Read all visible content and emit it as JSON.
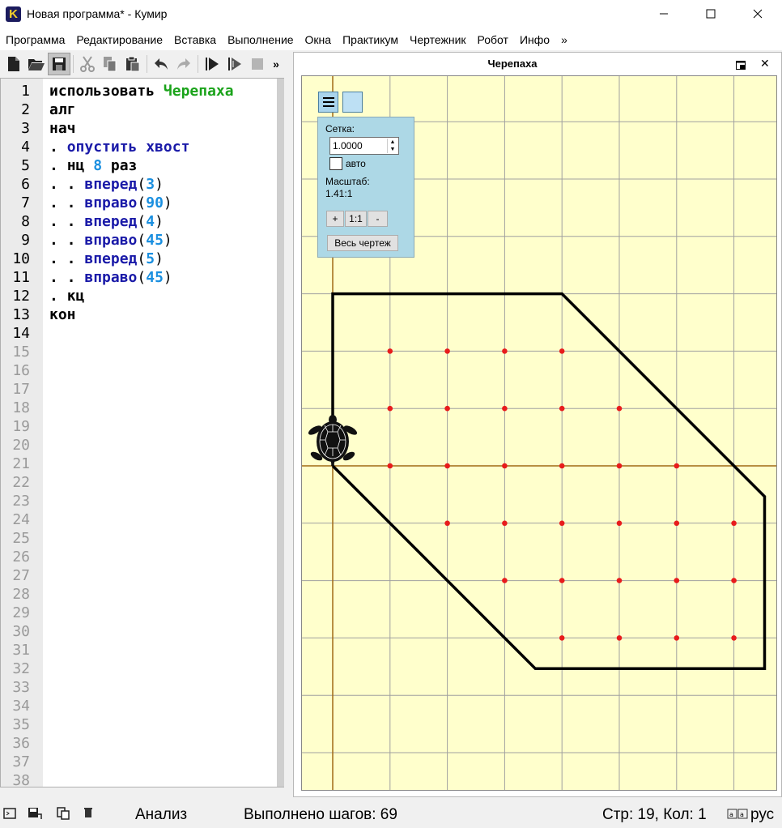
{
  "window": {
    "title": "Новая программа* - Кумир",
    "icon_letter": "K"
  },
  "menu": [
    "Программа",
    "Редактирование",
    "Вставка",
    "Выполнение",
    "Окна",
    "Практикум",
    "Чертежник",
    "Робот",
    "Инфо",
    "»"
  ],
  "toolbar": {
    "icons": [
      "new-file-icon",
      "open-folder-icon",
      "save-icon",
      "cut-icon",
      "copy-icon",
      "paste-icon",
      "undo-icon",
      "redo-icon",
      "run-icon",
      "step-icon",
      "stop-icon"
    ],
    "more_label": "»"
  },
  "editor": {
    "line_count": 38,
    "filled_lines": 14,
    "lines": [
      [
        {
          "t": "использовать ",
          "c": "kw"
        },
        {
          "t": "Черепаха",
          "c": "mod"
        }
      ],
      [
        {
          "t": "алг",
          "c": "kw"
        }
      ],
      [
        {
          "t": "нач",
          "c": "kw"
        }
      ],
      [
        {
          "t": ". ",
          "c": "dot"
        },
        {
          "t": "опустить хвост",
          "c": "cmd"
        }
      ],
      [
        {
          "t": ". ",
          "c": "dot"
        },
        {
          "t": "нц ",
          "c": "kw"
        },
        {
          "t": "8",
          "c": "num"
        },
        {
          "t": " раз",
          "c": "kw"
        }
      ],
      [
        {
          "t": ". . ",
          "c": "dot"
        },
        {
          "t": "вперед",
          "c": "cmd"
        },
        {
          "t": "(",
          "c": ""
        },
        {
          "t": "3",
          "c": "num"
        },
        {
          "t": ")",
          "c": ""
        }
      ],
      [
        {
          "t": ". . ",
          "c": "dot"
        },
        {
          "t": "вправо",
          "c": "cmd"
        },
        {
          "t": "(",
          "c": ""
        },
        {
          "t": "90",
          "c": "num"
        },
        {
          "t": ")",
          "c": ""
        }
      ],
      [
        {
          "t": ". . ",
          "c": "dot"
        },
        {
          "t": "вперед",
          "c": "cmd"
        },
        {
          "t": "(",
          "c": ""
        },
        {
          "t": "4",
          "c": "num"
        },
        {
          "t": ")",
          "c": ""
        }
      ],
      [
        {
          "t": ". . ",
          "c": "dot"
        },
        {
          "t": "вправо",
          "c": "cmd"
        },
        {
          "t": "(",
          "c": ""
        },
        {
          "t": "45",
          "c": "num"
        },
        {
          "t": ")",
          "c": ""
        }
      ],
      [
        {
          "t": ". . ",
          "c": "dot"
        },
        {
          "t": "вперед",
          "c": "cmd"
        },
        {
          "t": "(",
          "c": ""
        },
        {
          "t": "5",
          "c": "num"
        },
        {
          "t": ")",
          "c": ""
        }
      ],
      [
        {
          "t": ". . ",
          "c": "dot"
        },
        {
          "t": "вправо",
          "c": "cmd"
        },
        {
          "t": "(",
          "c": ""
        },
        {
          "t": "45",
          "c": "num"
        },
        {
          "t": ")",
          "c": ""
        }
      ],
      [
        {
          "t": ". ",
          "c": "dot"
        },
        {
          "t": "кц",
          "c": "kw"
        }
      ],
      [
        {
          "t": "кон",
          "c": "kw"
        }
      ]
    ]
  },
  "turtle_panel": {
    "title": "Черепаха",
    "close_label": "✕",
    "grid": {
      "label": "Сетка:",
      "value": "1.0000",
      "auto_label": "авто",
      "auto_checked": false,
      "scale_label": "Масштаб:",
      "scale_value": "1.41:1",
      "zoom_in_label": "+",
      "zoom_reset_label": "1:1",
      "zoom_out_label": "-",
      "fit_label": "Весь чертеж"
    },
    "path_units": [
      [
        0,
        0
      ],
      [
        0,
        3
      ],
      [
        4,
        3
      ],
      [
        7.5355,
        -0.5355
      ],
      [
        7.5355,
        -3.5355
      ],
      [
        3.5355,
        -3.5355
      ],
      [
        0,
        0
      ]
    ],
    "marks_units": [
      [
        1,
        2
      ],
      [
        2,
        2
      ],
      [
        3,
        2
      ],
      [
        4,
        2
      ],
      [
        1,
        1
      ],
      [
        2,
        1
      ],
      [
        3,
        1
      ],
      [
        4,
        1
      ],
      [
        5,
        1
      ],
      [
        1,
        0
      ],
      [
        2,
        0
      ],
      [
        3,
        0
      ],
      [
        4,
        0
      ],
      [
        5,
        0
      ],
      [
        6,
        0
      ],
      [
        2,
        -1
      ],
      [
        3,
        -1
      ],
      [
        4,
        -1
      ],
      [
        5,
        -1
      ],
      [
        6,
        -1
      ],
      [
        7,
        -1
      ],
      [
        3,
        -2
      ],
      [
        4,
        -2
      ],
      [
        5,
        -2
      ],
      [
        6,
        -2
      ],
      [
        7,
        -2
      ],
      [
        4,
        -3
      ],
      [
        5,
        -3
      ],
      [
        6,
        -3
      ],
      [
        7,
        -3
      ]
    ],
    "colors": {
      "background": "#ffffcc",
      "grid": "#a0a0a0",
      "axis": "#a06a14",
      "path": "#000000",
      "marks": "#e81c1c"
    }
  },
  "status": {
    "mode": "Анализ",
    "steps": "Выполнено шагов: 69",
    "position": "Стр: 19, Кол: 1",
    "language": "рус"
  }
}
